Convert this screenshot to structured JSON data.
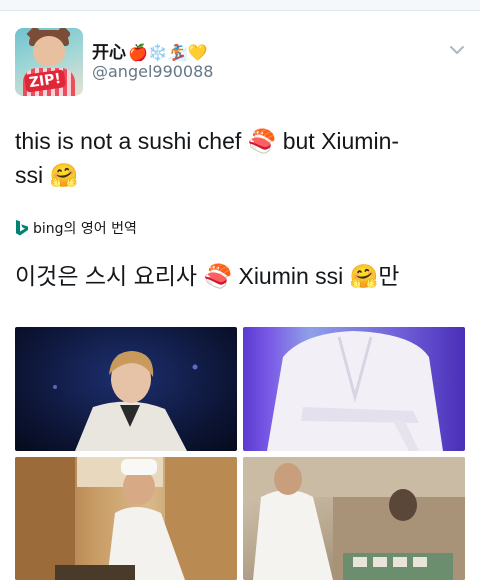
{
  "tweet": {
    "display_name": "开心",
    "name_emojis": "🍎❄️🏂💛",
    "handle": "@angel990088",
    "text_line1": "this is not a sushi chef 🍣 but Xiumin-",
    "text_line2": "ssi 🤗",
    "translation_label": "bing의 영어 번역",
    "translated_text": "이것은 스시 요리사 🍣 Xiumin ssi 🤗만",
    "avatar_badge": "ZIP!"
  },
  "photos": [
    {
      "name": "photo-xiumin-smiling"
    },
    {
      "name": "photo-white-robe"
    },
    {
      "name": "photo-sushi-chef"
    },
    {
      "name": "photo-chef-at-counter"
    }
  ],
  "colors": {
    "handle": "#657786",
    "text": "#14171a",
    "bing": "#008373"
  }
}
